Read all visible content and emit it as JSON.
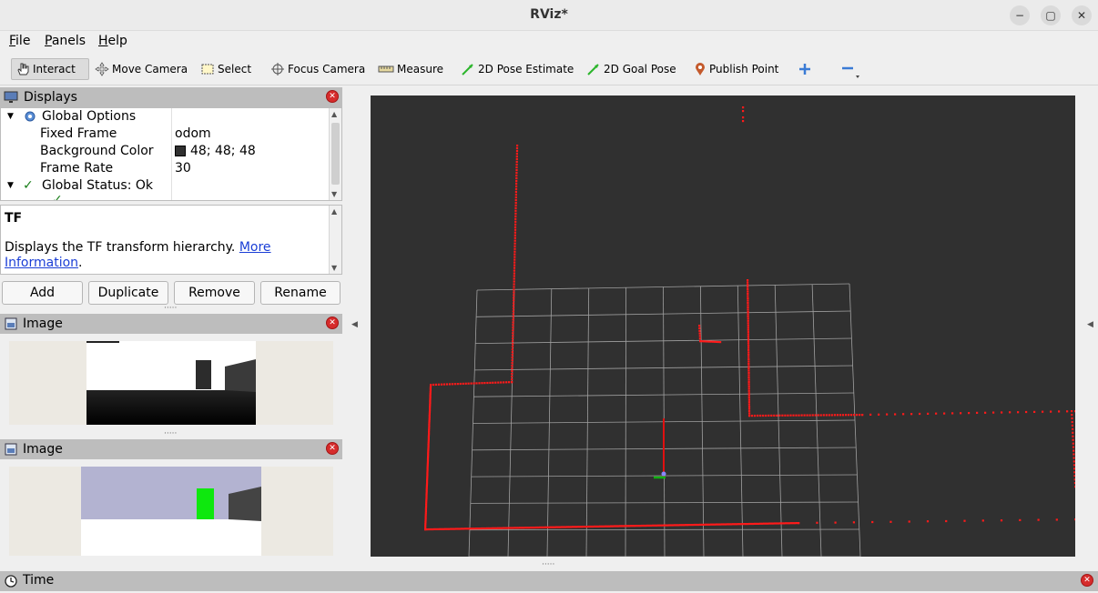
{
  "window": {
    "title": "RViz*",
    "controls": [
      "−",
      "▢",
      "✕"
    ]
  },
  "menu": {
    "items": [
      {
        "accel": "F",
        "rest": "ile"
      },
      {
        "accel": "P",
        "rest": "anels"
      },
      {
        "accel": "H",
        "rest": "elp"
      }
    ]
  },
  "toolbar": {
    "interact": "Interact",
    "move_camera": "Move Camera",
    "select": "Select",
    "focus_camera": "Focus Camera",
    "measure": "Measure",
    "pose_estimate": "2D Pose Estimate",
    "goal_pose": "2D Goal Pose",
    "publish_point": "Publish Point"
  },
  "displays": {
    "title": "Displays",
    "tree": {
      "global_options": "Global Options",
      "fixed_frame": {
        "name": "Fixed Frame",
        "value": "odom"
      },
      "background_color": {
        "name": "Background Color",
        "value": "48; 48; 48",
        "swatch": "#303030"
      },
      "frame_rate": {
        "name": "Frame Rate",
        "value": "30"
      },
      "global_status": "Global Status: Ok"
    },
    "description": {
      "title": "TF",
      "text": "Displays the TF transform hierarchy.",
      "link_1": "More",
      "link_2": "Information",
      "tail": "."
    },
    "buttons": {
      "add": "Add",
      "duplicate": "Duplicate",
      "remove": "Remove",
      "rename": "Rename"
    }
  },
  "image_panel_1": {
    "title": "Image"
  },
  "image_panel_2": {
    "title": "Image"
  },
  "time_panel": {
    "title": "Time"
  },
  "colors": {
    "background": "#303030",
    "laser": "#ff1a1a",
    "grid": "#a0a0a0",
    "accent_close": "#d62b2b"
  }
}
